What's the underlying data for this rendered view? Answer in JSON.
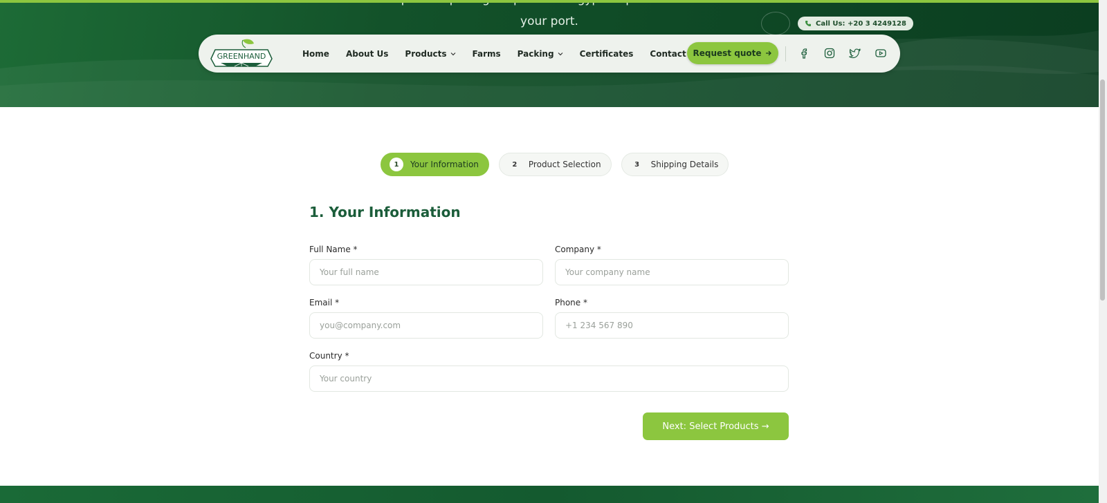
{
  "hero": {
    "subtitle_line1": "Get competitive pricing for premium Egyptian produce delivered to",
    "subtitle_line2": "your port.",
    "call_label": "Call Us: +20 3 4249128"
  },
  "brand": {
    "name": "GREENHAND",
    "accent": "#8cc63f",
    "dark_green": "#13522a",
    "title_green": "#1b5d3a"
  },
  "nav": {
    "items": [
      {
        "label": "Home",
        "dropdown": false
      },
      {
        "label": "About Us",
        "dropdown": false
      },
      {
        "label": "Products",
        "dropdown": true
      },
      {
        "label": "Farms",
        "dropdown": false
      },
      {
        "label": "Packing",
        "dropdown": true
      },
      {
        "label": "Certificates",
        "dropdown": false
      },
      {
        "label": "Contact",
        "dropdown": false
      }
    ],
    "quote_label": "Request quote",
    "social_icons": [
      "facebook-icon",
      "instagram-icon",
      "twitter-icon",
      "youtube-icon"
    ]
  },
  "steps": [
    {
      "num": "1",
      "label": "Your Information",
      "active": true
    },
    {
      "num": "2",
      "label": "Product Selection",
      "active": false
    },
    {
      "num": "3",
      "label": "Shipping Details",
      "active": false
    }
  ],
  "form": {
    "title": "1. Your Information",
    "full_name": {
      "label": "Full Name *",
      "placeholder": "Your full name",
      "value": ""
    },
    "company": {
      "label": "Company *",
      "placeholder": "Your company name",
      "value": ""
    },
    "email": {
      "label": "Email *",
      "placeholder": "you@company.com",
      "value": ""
    },
    "phone": {
      "label": "Phone *",
      "placeholder": "+1 234 567 890",
      "value": ""
    },
    "country": {
      "label": "Country *",
      "placeholder": "Your country",
      "value": ""
    },
    "next_label": "Next: Select Products →"
  }
}
